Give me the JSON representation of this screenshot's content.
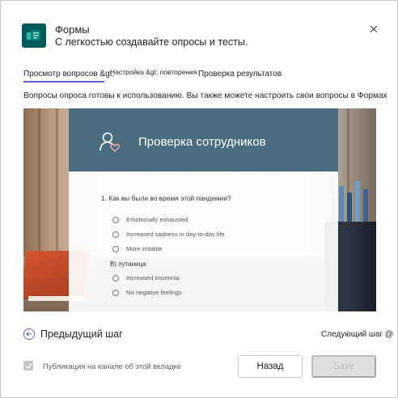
{
  "header": {
    "title": "Формы",
    "subtitle": "С легкостью создавайте опросы и тесты."
  },
  "tabs": [
    {
      "label": "Просмотр вопросов &gt;"
    },
    {
      "label": "Настройка &gt; повторения"
    },
    {
      "label": "Проверка результатов"
    }
  ],
  "active_tab": 0,
  "intro_text": "Вопросы опроса готовы к использованию. Вы также можете настроить свои вопросы в Формах. О",
  "preview": {
    "form_title": "Проверка сотрудников",
    "question": "1. Как вы были во время этой пандемии?",
    "options_group_1": [
      "Emotionally exhausted",
      "Increased sadness in day-to-day life",
      "More irritable"
    ],
    "section_label": "B) путаница",
    "options_group_2": [
      "Increased insomnia",
      "No negative feelings"
    ]
  },
  "footer": {
    "prev_step": "Предыдущий шаг",
    "next_step": "Следующий шаг @",
    "publish_label": "Публикация на канале об этой вкладке",
    "publish_checked": true,
    "back_button": "Назад",
    "save_button": "Save"
  },
  "colors": {
    "brand_purple": "#5b5fc7",
    "forms_teal": "#035a5a",
    "form_header": "#496c7e"
  },
  "icons": {
    "logo": "forms-logo-icon",
    "close": "close-icon",
    "person": "person-heart-icon",
    "prev": "arrow-left-circle-icon",
    "checkbox": "checkmark-icon"
  }
}
